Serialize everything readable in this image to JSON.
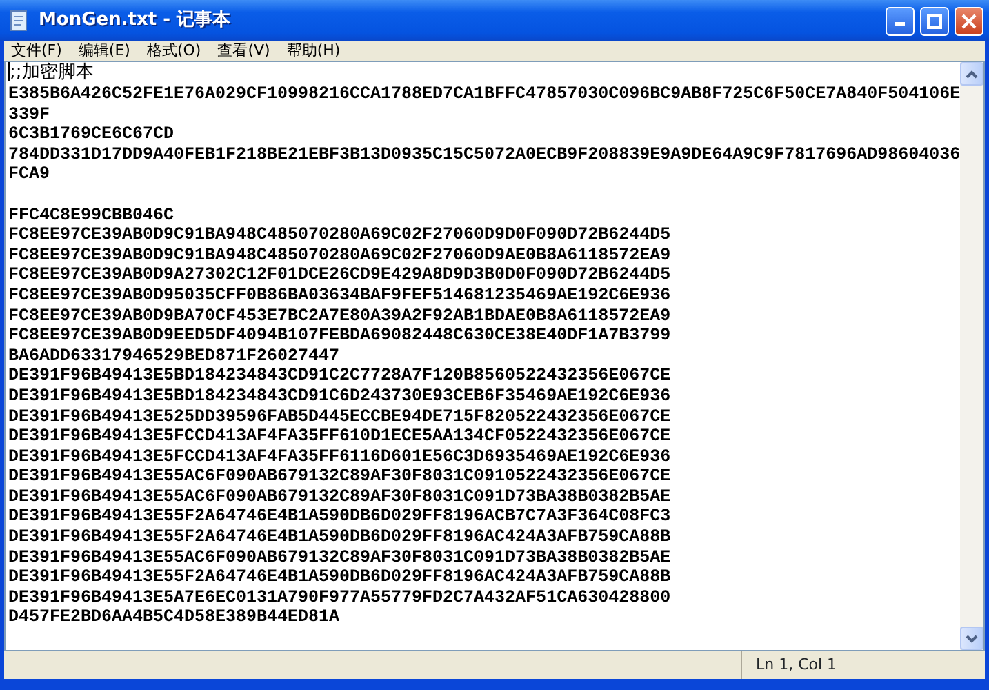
{
  "window": {
    "title": "MonGen.txt - 记事本"
  },
  "menu": [
    "文件(F)",
    "编辑(E)",
    "格式(O)",
    "查看(V)",
    "帮助(H)"
  ],
  "lines": [
    {
      "text": ";;加密脚本"
    },
    {
      "text": "E385B6A426C52FE1E76A029CF10998216CCA1788ED7CA1BFFC47857030C096BC9AB8F725C6F50CE7A840F504106E"
    },
    {
      "text": "339F"
    },
    {
      "text": "6C3B1769CE6C67CD"
    },
    {
      "text": "784DD331D17DD9A40FEB1F218BE21EBF3B13D0935C15C5072A0ECB9F208839E9A9DE64A9C9F7817696AD98604036"
    },
    {
      "text": "FCA9"
    },
    {
      "text": "FFC4C8E99CBB046C",
      "blank_before": true
    },
    {
      "text": "FC8EE97CE39AB0D9C91BA948C485070280A69C02F27060D9D0F090D72B6244D5"
    },
    {
      "text": "FC8EE97CE39AB0D9C91BA948C485070280A69C02F27060D9AE0B8A6118572EA9"
    },
    {
      "text": "FC8EE97CE39AB0D9A27302C12F01DCE26CD9E429A8D9D3B0D0F090D72B6244D5"
    },
    {
      "text": "FC8EE97CE39AB0D95035CFF0B86BA03634BAF9FEF514681235469AE192C6E936"
    },
    {
      "text": "FC8EE97CE39AB0D9BA70CF453E7BC2A7E80A39A2F92AB1BDAE0B8A6118572EA9"
    },
    {
      "text": "FC8EE97CE39AB0D9EED5DF4094B107FEBDA69082448C630CE38E40DF1A7B3799"
    },
    {
      "text": "BA6ADD63317946529BED871F26027447"
    },
    {
      "text": "DE391F96B49413E5BD184234843CD91C2C7728A7F120B8560522432356E067CE"
    },
    {
      "text": "DE391F96B49413E5BD184234843CD91C6D243730E93CEB6F35469AE192C6E936"
    },
    {
      "text": "DE391F96B49413E525DD39596FAB5D445ECCBE94DE715F820522432356E067CE"
    },
    {
      "text": "DE391F96B49413E5FCCD413AF4FA35FF610D1ECE5AA134CF0522432356E067CE"
    },
    {
      "text": "DE391F96B49413E5FCCD413AF4FA35FF6116D601E56C3D6935469AE192C6E936"
    },
    {
      "text": "DE391F96B49413E55AC6F090AB679132C89AF30F8031C0910522432356E067CE"
    },
    {
      "text": "DE391F96B49413E55AC6F090AB679132C89AF30F8031C091D73BA38B0382B5AE"
    },
    {
      "text": "DE391F96B49413E55F2A64746E4B1A590DB6D029FF8196ACB7C7A3F364C08FC3"
    },
    {
      "text": "DE391F96B49413E55F2A64746E4B1A590DB6D029FF8196AC424A3AFB759CA88B"
    },
    {
      "text": "DE391F96B49413E55AC6F090AB679132C89AF30F8031C091D73BA38B0382B5AE"
    },
    {
      "text": "DE391F96B49413E55F2A64746E4B1A590DB6D029FF8196AC424A3AFB759CA88B"
    },
    {
      "text": "DE391F96B49413E5A7E6EC0131A790F977A55779FD2C7A432AF51CA630428800"
    },
    {
      "text": "D457FE2BD6AA4B5C4D58E389B44ED81A"
    }
  ],
  "status_bar": {
    "position": "Ln 1, Col 1"
  }
}
